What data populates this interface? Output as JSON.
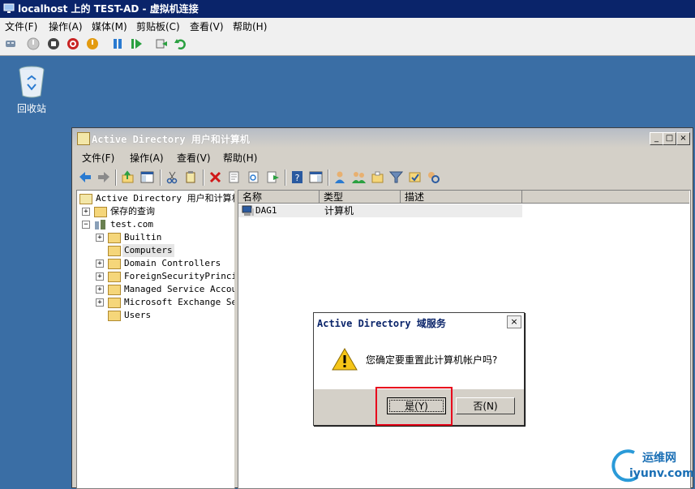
{
  "vm_window": {
    "title": "localhost 上的 TEST-AD - 虚拟机连接",
    "menu": [
      "文件(F)",
      "操作(A)",
      "媒体(M)",
      "剪贴板(C)",
      "查看(V)",
      "帮助(H)"
    ],
    "toolbar_icons": [
      "ctrl-alt-del-icon",
      "start-icon",
      "turnoff-icon",
      "shutdown-icon",
      "power-icon",
      "pause-icon",
      "resume-icon",
      "snapshot-icon",
      "revert-icon"
    ]
  },
  "desktop": {
    "recycle_bin_label": "回收站"
  },
  "ad_window": {
    "title": "Active Directory 用户和计算机",
    "menu": [
      "文件(F)",
      "操作(A)",
      "查看(V)",
      "帮助(H)"
    ],
    "tree": {
      "root": "Active Directory 用户和计算机",
      "saved_queries": "保存的查询",
      "domain": "test.com",
      "children": [
        "Builtin",
        "Computers",
        "Domain Controllers",
        "ForeignSecurityPrincip",
        "Managed Service Accour",
        "Microsoft Exchange Sec",
        "Users"
      ]
    },
    "list": {
      "columns": [
        "名称",
        "类型",
        "描述"
      ],
      "rows": [
        {
          "name": "DAG1",
          "type": "计算机",
          "description": ""
        }
      ]
    }
  },
  "dialog": {
    "title": "Active Directory 域服务",
    "message": "您确定要重置此计算机帐户吗?",
    "yes_label": "是(Y)",
    "no_label": "否(N)"
  },
  "watermark": {
    "line1": "运维网",
    "line2": "iyunv.com"
  }
}
